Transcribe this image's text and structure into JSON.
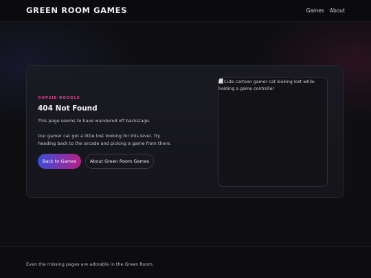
{
  "header": {
    "brand": "GREEN ROOM GAMES",
    "nav": [
      "Games",
      "About"
    ]
  },
  "main": {
    "eyebrow": "OOPSIE-DOODLE",
    "title": "404 Not Found",
    "subtitle": "This page seems to have wandered off backstage.",
    "body": "Our gamer cat got a little lost looking for this level. Try heading back to the arcade and picking a game from there.",
    "primary_button": "Back to Games",
    "secondary_button": "About Green Room Games",
    "image_alt": "Cute cartoon gamer cat looking lost while holding a game controller",
    "image_icon": "broken-image-icon"
  },
  "footer": {
    "text": "Even the missing pages are adorable in the Green Room."
  },
  "colors": {
    "accent_pink": "#d23e8c",
    "button_gradient_start": "#3b4ed8",
    "button_gradient_end": "#b51f86",
    "background": "#0f0f12"
  }
}
